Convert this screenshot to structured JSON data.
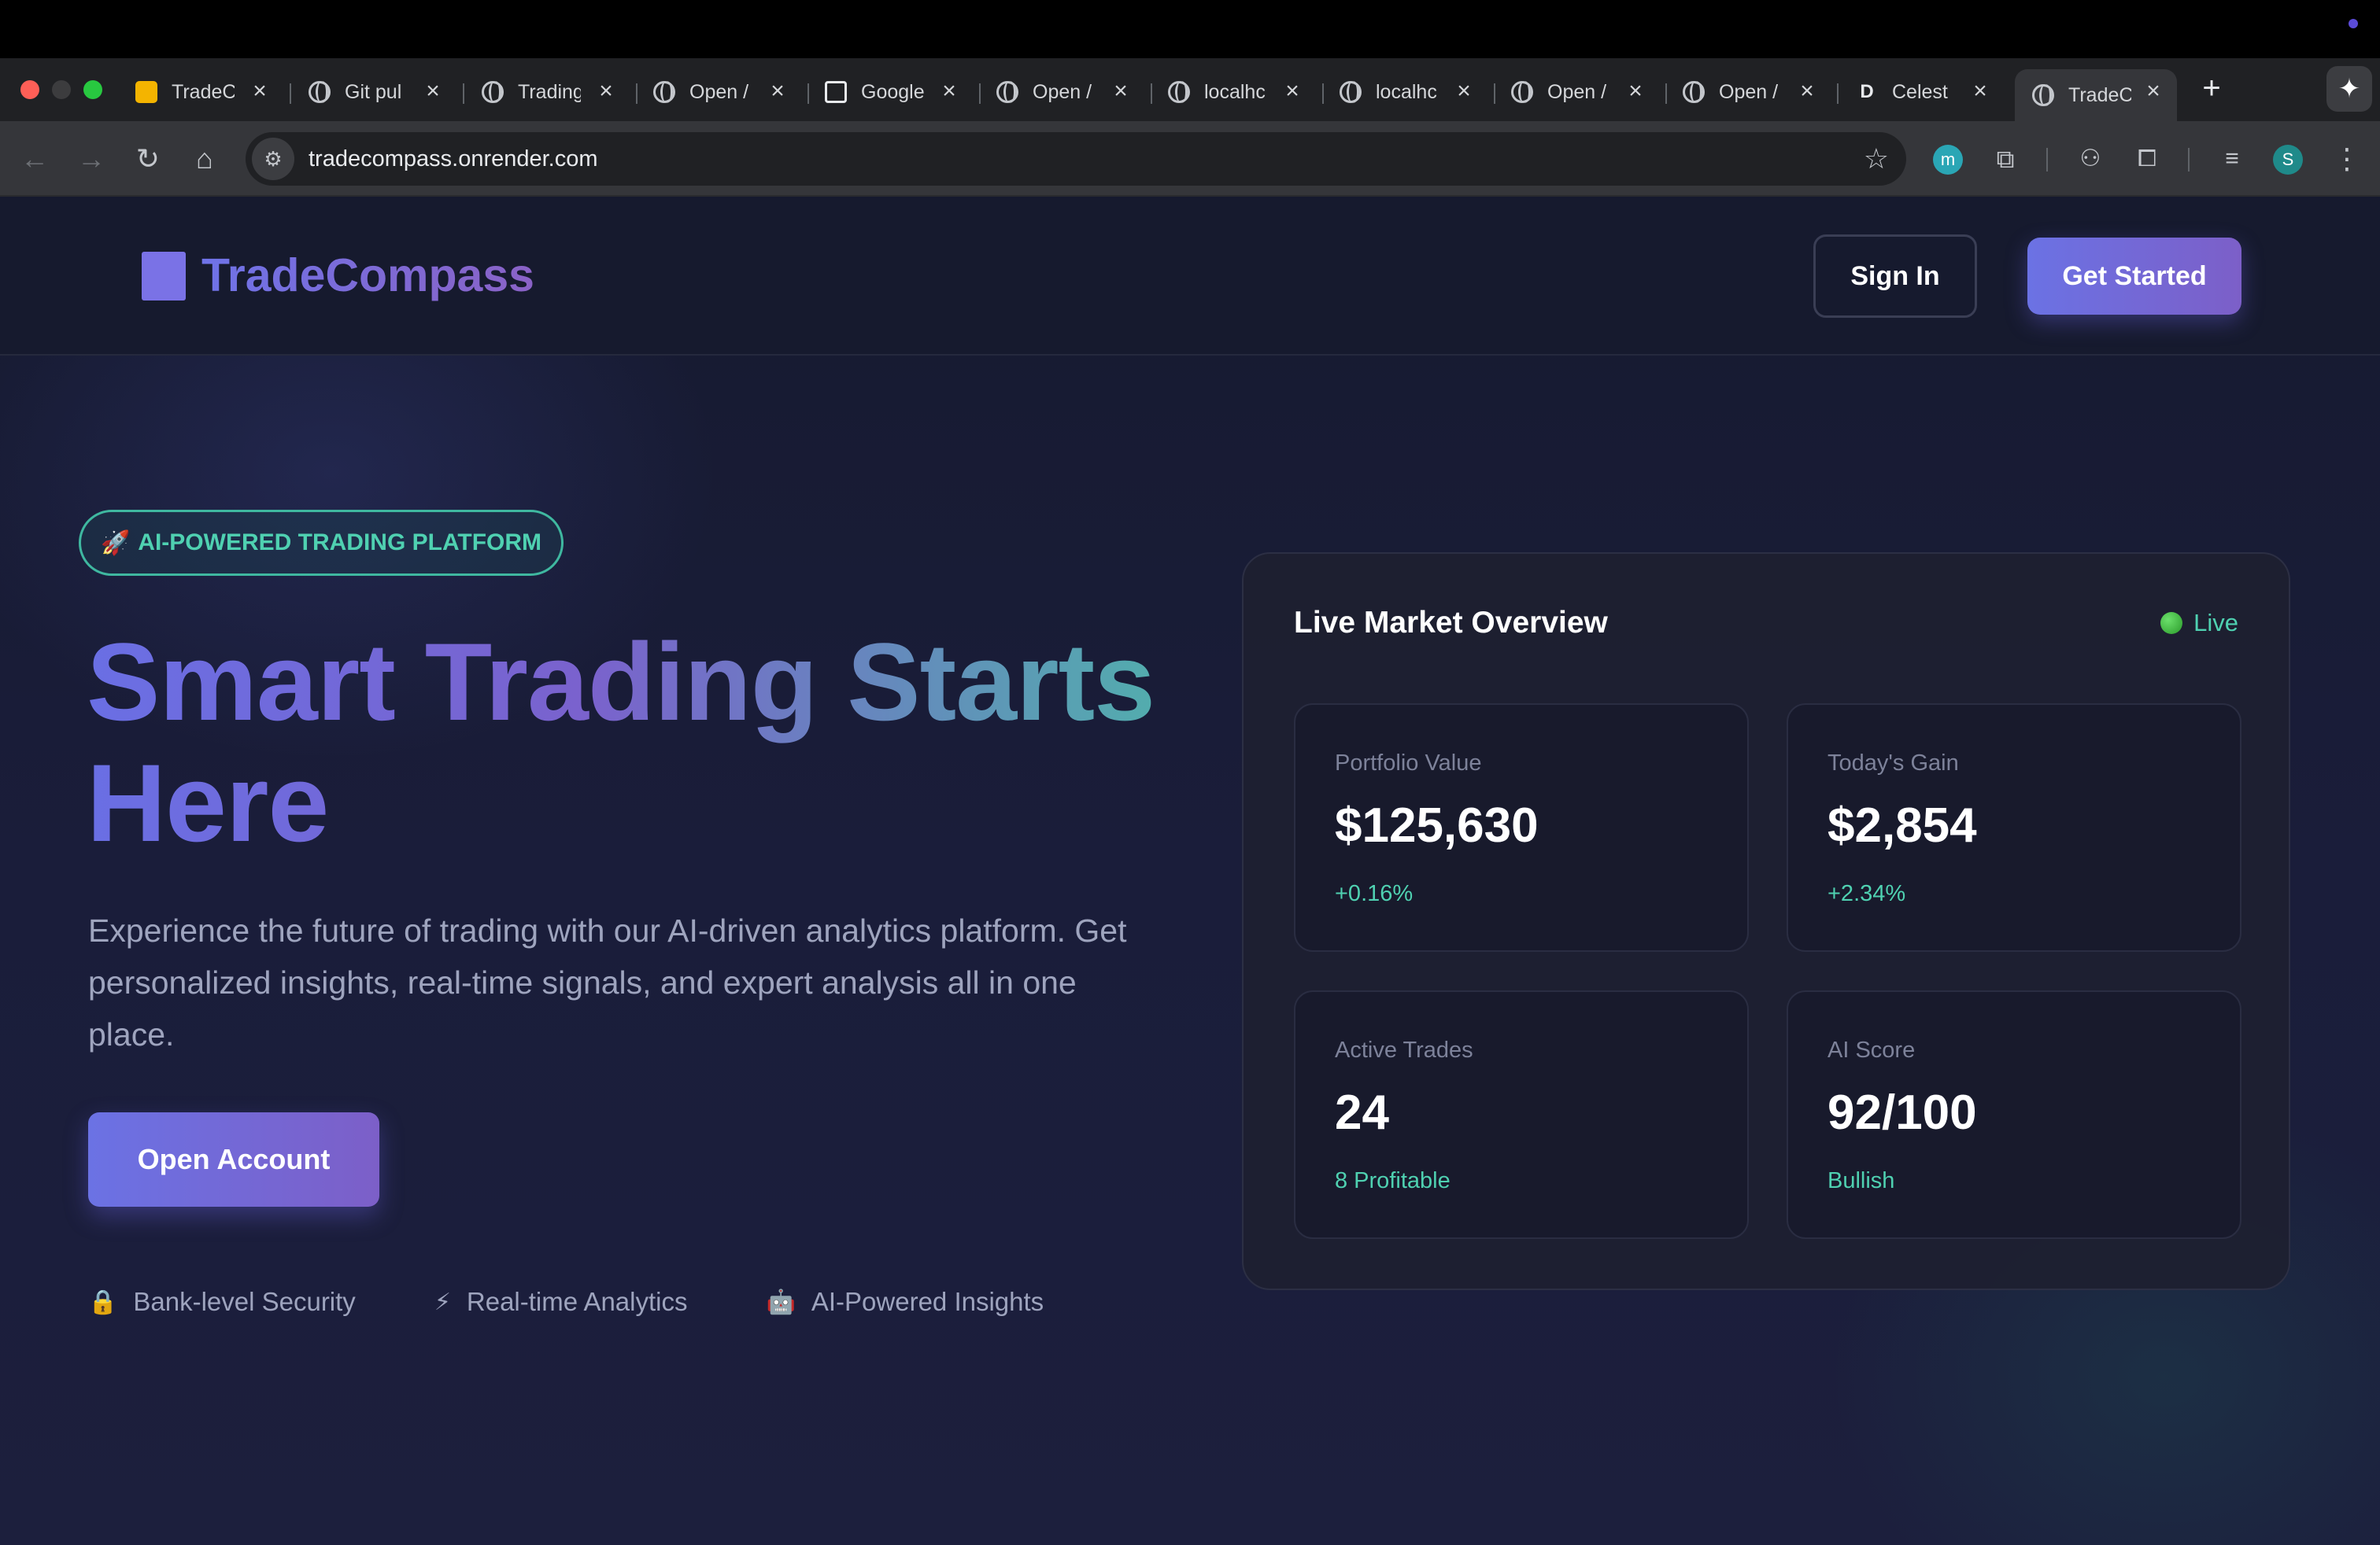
{
  "browser": {
    "tabs": [
      {
        "title": "TradeC",
        "icon": "slides-icon"
      },
      {
        "title": "Git pul",
        "icon": "openai-icon"
      },
      {
        "title": "Trading",
        "icon": "globe-icon"
      },
      {
        "title": "Open /",
        "icon": "globe-icon"
      },
      {
        "title": "Google",
        "icon": "external-icon"
      },
      {
        "title": "Open /",
        "icon": "globe-icon"
      },
      {
        "title": "localhc",
        "icon": "globe-icon"
      },
      {
        "title": "localhc",
        "icon": "globe-icon"
      },
      {
        "title": "Open /",
        "icon": "globe-icon"
      },
      {
        "title": "Open /",
        "icon": "globe-icon"
      },
      {
        "title": "Celest",
        "icon": "d-icon",
        "icon_letter": "D"
      },
      {
        "title": "TradeC",
        "icon": "globe-icon",
        "active": true
      }
    ],
    "url": "tradecompass.onrender.com",
    "profile_initial": "S",
    "extension_initial": "m"
  },
  "header": {
    "logo_text": "TradeCompass",
    "sign_in": "Sign In",
    "get_started": "Get Started"
  },
  "hero": {
    "badge_icon": "🚀",
    "badge": "AI-POWERED TRADING PLATFORM",
    "title": "Smart Trading Starts Here",
    "description": "Experience the future of trading with our AI-driven analytics platform. Get personalized insights, real-time signals, and expert analysis all in one place.",
    "cta": "Open Account",
    "features": [
      {
        "icon": "🔒",
        "label": "Bank-level Security"
      },
      {
        "icon": "⚡",
        "label": "Real-time Analytics"
      },
      {
        "icon": "🤖",
        "label": "AI-Powered Insights"
      }
    ]
  },
  "market": {
    "title": "Live Market Overview",
    "live_label": "Live",
    "stats": [
      {
        "label": "Portfolio Value",
        "value": "$125,630",
        "sub": "+0.16%"
      },
      {
        "label": "Today's Gain",
        "value": "$2,854",
        "sub": "+2.34%"
      },
      {
        "label": "Active Trades",
        "value": "24",
        "sub": "8 Profitable"
      },
      {
        "label": "AI Score",
        "value": "92/100",
        "sub": "Bullish"
      }
    ]
  },
  "colors": {
    "accent": "#6b72e4",
    "accent_purple": "#7c5fc8",
    "teal": "#4fd1b1",
    "background": "#1a1d3a"
  }
}
